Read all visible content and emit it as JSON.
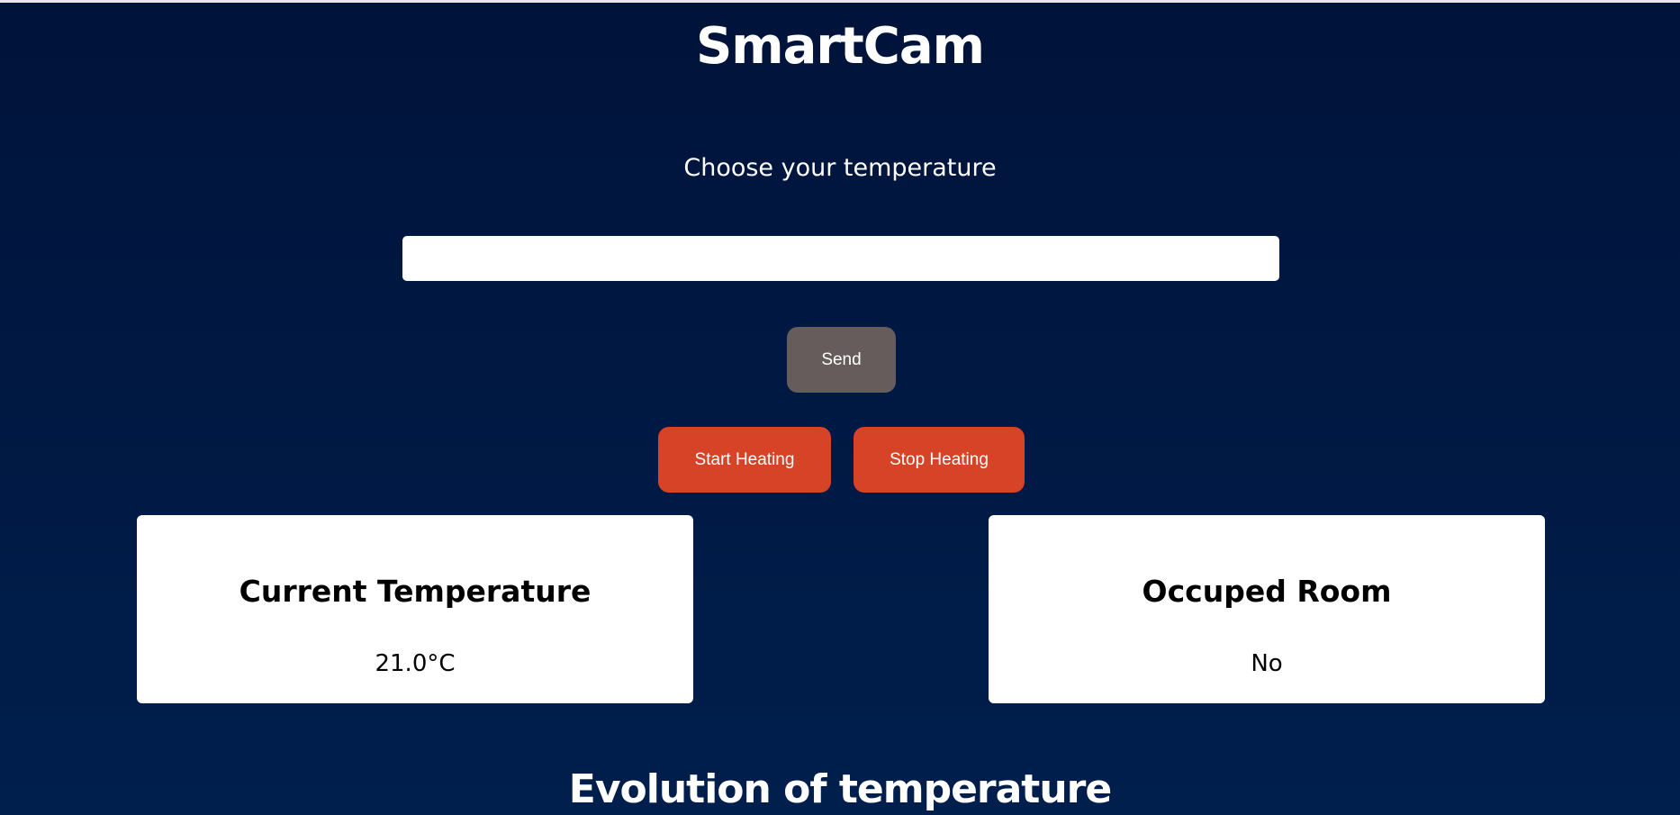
{
  "header": {
    "title": "SmartCam"
  },
  "form": {
    "label": "Choose your temperature",
    "input_value": "",
    "input_placeholder": "",
    "send_label": "Send"
  },
  "controls": {
    "start_label": "Start Heating",
    "stop_label": "Stop Heating"
  },
  "cards": [
    {
      "title": "Current Temperature",
      "value": "21.0°C"
    },
    {
      "title": "Occuped Room",
      "value": "No"
    }
  ],
  "chart_section": {
    "title": "Evolution of temperature"
  },
  "colors": {
    "background": "#001a45",
    "send": "#655c5b",
    "heating": "#d64327"
  }
}
